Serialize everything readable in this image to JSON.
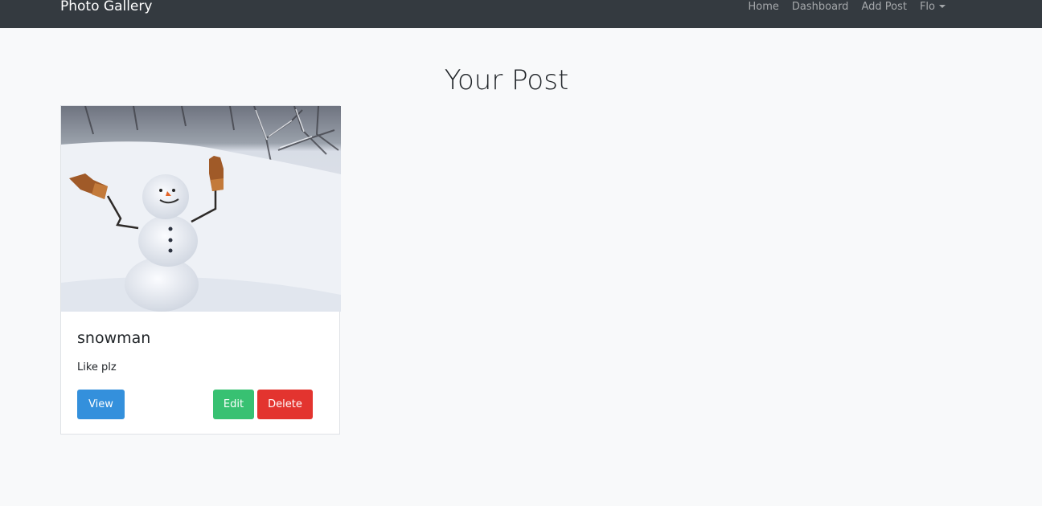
{
  "navbar": {
    "brand": "Photo Gallery",
    "links": [
      "Home",
      "Dashboard",
      "Add Post"
    ],
    "user_menu": "Flo"
  },
  "main": {
    "title": "Your Post",
    "posts": [
      {
        "title": "snowman",
        "description": "Like plz",
        "view_label": "View",
        "edit_label": "Edit",
        "delete_label": "Delete"
      }
    ]
  },
  "colors": {
    "navbar": "#343a40",
    "view": "#3490dc",
    "edit": "#38c172",
    "delete": "#e3342f"
  }
}
